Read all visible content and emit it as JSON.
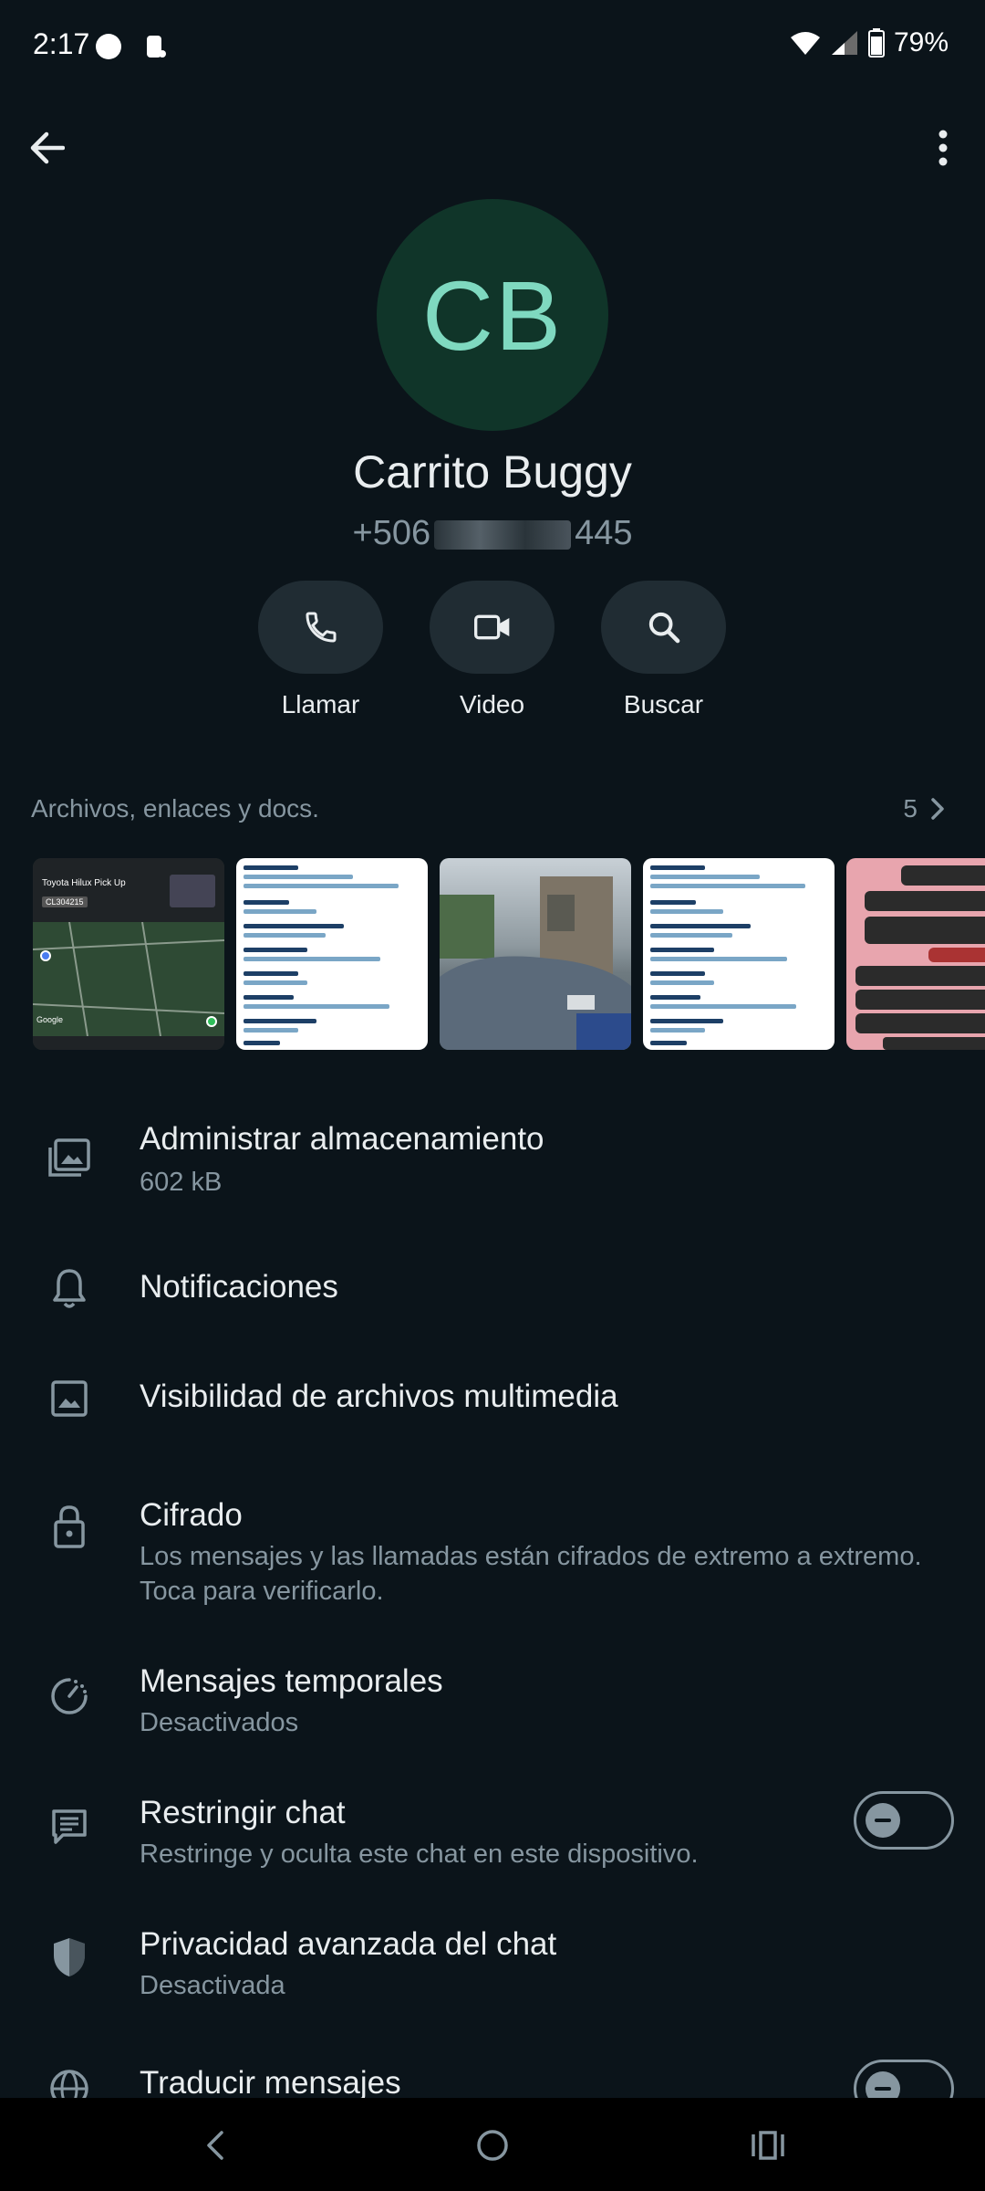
{
  "status": {
    "time": "2:17",
    "battery": "79%"
  },
  "contact": {
    "initials": "CB",
    "name": "Carrito Buggy",
    "phone_prefix": "+506",
    "phone_suffix": "445"
  },
  "actions": [
    {
      "label": "Llamar",
      "icon": "phone-icon"
    },
    {
      "label": "Video",
      "icon": "video-icon"
    },
    {
      "label": "Buscar",
      "icon": "search-icon"
    }
  ],
  "media": {
    "title": "Archivos, enlaces y docs.",
    "count": "5",
    "map_title": "Toyota Hilux Pick Up",
    "map_plate": "CL304215",
    "map_brand": "Google"
  },
  "settings": [
    {
      "title": "Administrar almacenamiento",
      "subtitle": "602 kB",
      "icon": "storage-icon"
    },
    {
      "title": "Notificaciones",
      "icon": "bell-icon"
    },
    {
      "title": "Visibilidad de archivos multimedia",
      "icon": "image-icon"
    },
    {
      "title": "Cifrado",
      "subtitle": "Los mensajes y las llamadas están cifrados de extremo a extremo. Toca para verificarlo.",
      "icon": "lock-icon"
    },
    {
      "title": "Mensajes temporales",
      "subtitle": "Desactivados",
      "icon": "timer-icon"
    },
    {
      "title": "Restringir chat",
      "subtitle": "Restringe y oculta este chat en este dispositivo.",
      "icon": "restrict-chat-icon",
      "toggle": false
    },
    {
      "title": "Privacidad avanzada del chat",
      "subtitle": "Desactivada",
      "icon": "shield-icon"
    },
    {
      "title": "Traducir mensajes",
      "icon": "globe-icon",
      "toggle": false
    }
  ]
}
